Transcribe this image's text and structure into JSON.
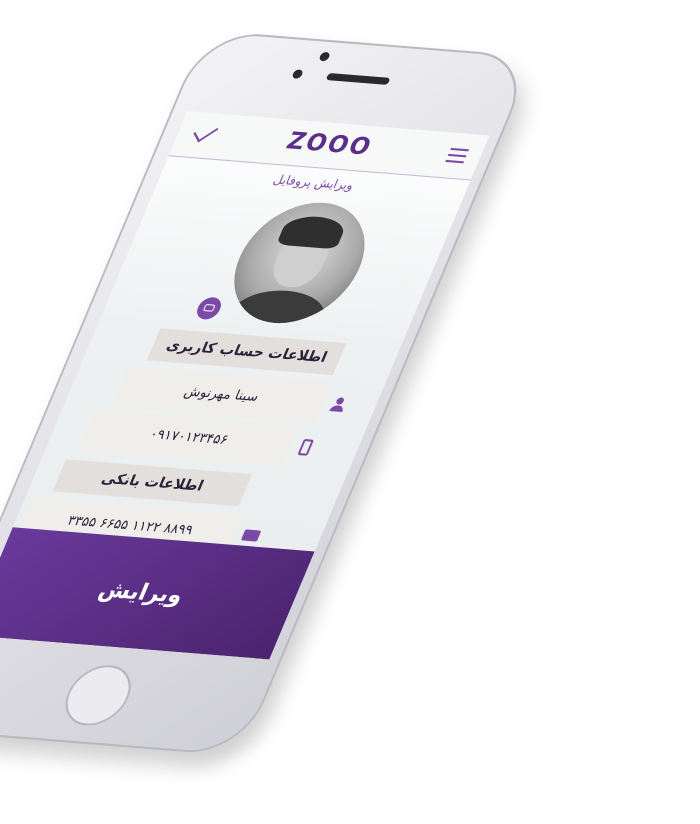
{
  "app": {
    "logo_text": "ZOOO",
    "page_title": "ویرایش پروفایل"
  },
  "account": {
    "section_title": "اطلاعات حساب کاربری",
    "name": "سینا مهرنوش",
    "phone": "۰۹۱۷۰۱۲۳۴۵۶"
  },
  "bank": {
    "section_title": "اطلاعات بانکی",
    "card_number": "۸۸۹۹ ۱۱۲۲ ۶۶۵۵ ۳۳۵۵"
  },
  "actions": {
    "submit_label": "ویرایش"
  },
  "icons": {
    "confirm": "check-icon",
    "menu": "menu-icon",
    "photo": "image-icon",
    "user": "user-icon",
    "mobile": "mobile-phone-icon",
    "card": "credit-card-icon"
  },
  "colors": {
    "brand": "#5b2f88",
    "accent": "#7a4aa6",
    "button": "#6a3a9c",
    "section_bg": "#e2dfdc",
    "field_bg": "#f0eeea"
  }
}
